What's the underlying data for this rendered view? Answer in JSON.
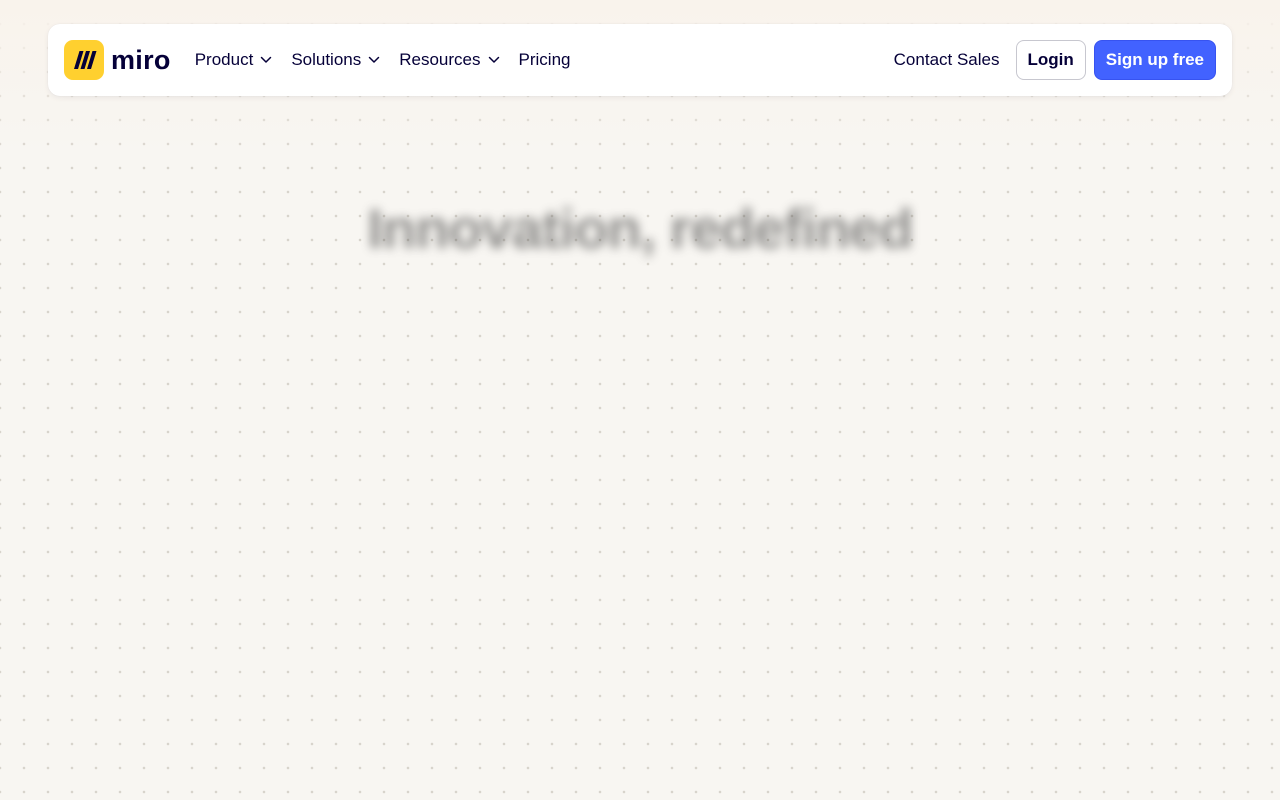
{
  "brand": {
    "name": "miro",
    "logo_icon": "miro-logo-icon",
    "logo_color": "#ffd02f"
  },
  "nav": {
    "items": [
      {
        "label": "Product",
        "has_dropdown": true
      },
      {
        "label": "Solutions",
        "has_dropdown": true
      },
      {
        "label": "Resources",
        "has_dropdown": true
      },
      {
        "label": "Pricing",
        "has_dropdown": false
      }
    ],
    "dropdown_icon": "chevron-down-icon"
  },
  "actions": {
    "contact_sales": "Contact Sales",
    "login": "Login",
    "signup": "Sign up free"
  },
  "hero": {
    "title": "Innovation, redefined"
  },
  "colors": {
    "text": "#050038",
    "accent": "#4262ff",
    "page_background": "#f8f6f2"
  }
}
